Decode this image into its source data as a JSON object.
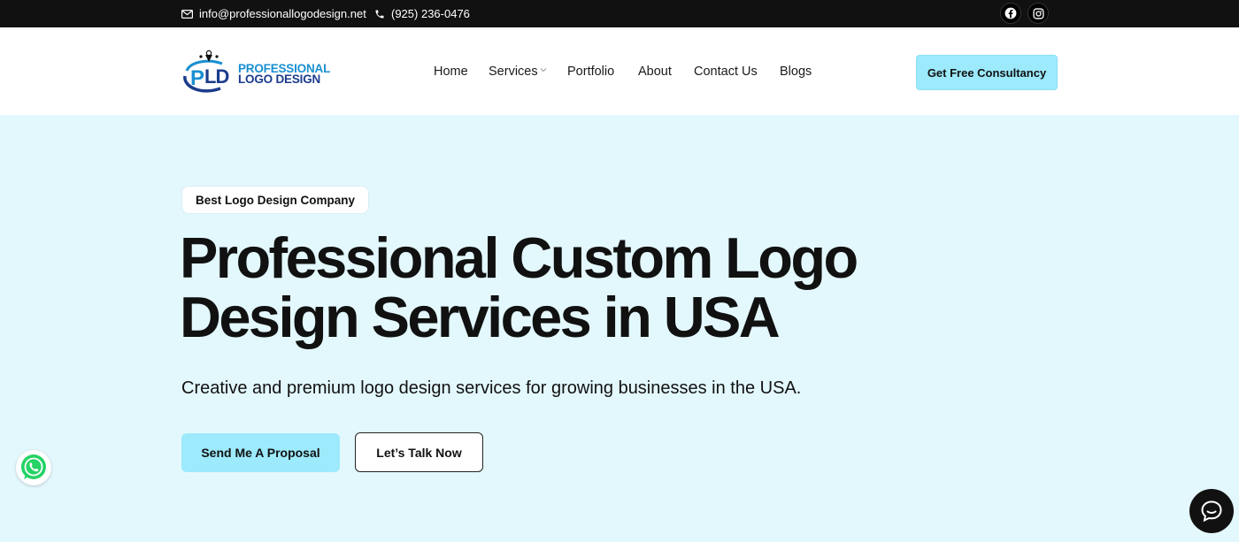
{
  "topbar": {
    "email": "info@professionallogodesign.net",
    "phone": "(925) 236-0476",
    "social_icons": [
      "facebook-icon",
      "instagram-icon"
    ]
  },
  "header": {
    "logo": {
      "line1": "PROFESSIONAL",
      "line2": "LOGO DESIGN",
      "mark": "PLD"
    },
    "nav": [
      {
        "label": "Home"
      },
      {
        "label": "Services",
        "has_dropdown": true
      },
      {
        "label": "Portfolio"
      },
      {
        "label": "About"
      },
      {
        "label": "Contact Us"
      },
      {
        "label": "Blogs"
      }
    ],
    "cta": "Get Free Consultancy"
  },
  "hero": {
    "badge": "Best Logo Design Company",
    "title_line1": "Professional Custom Logo",
    "title_line2": "Design Services in USA",
    "subtitle": "Creative and premium logo design services for growing businesses in the USA.",
    "primary_button": "Send Me A Proposal",
    "secondary_button": "Let’s Talk Now"
  },
  "floating": {
    "whatsapp": "whatsapp-icon",
    "chat": "chat-icon"
  },
  "colors": {
    "topbar_bg": "#111111",
    "hero_bg": "#e3f8fd",
    "accent": "#9ceafc",
    "logo_blue_light": "#1a8fd1",
    "logo_blue_dark": "#1b3c8c",
    "whatsapp_green": "#25d366"
  }
}
